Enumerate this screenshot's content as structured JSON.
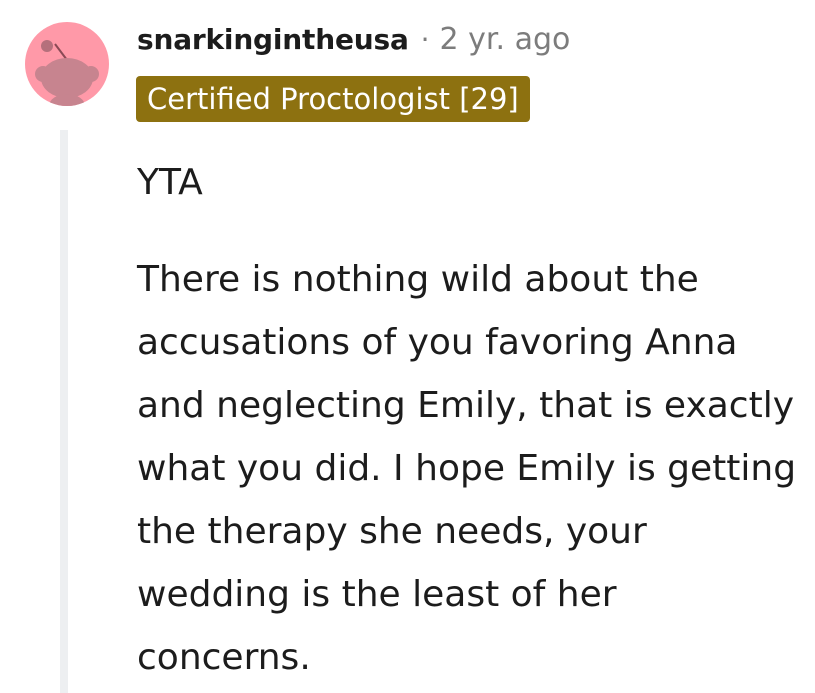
{
  "comment": {
    "username": "snarkingintheusa",
    "separator": "·",
    "timestamp": "2 yr. ago",
    "flair": "Certified Proctologist [29]",
    "body": [
      "YTA",
      "There is nothing wild about the accusations of you favoring Anna and neglecting Emily, that is exactly what you did. I hope Emily is getting the therapy she needs, your wedding is the least of her concerns."
    ],
    "avatar_icon": "snoo-avatar-icon",
    "colors": {
      "avatar_bg": "#ff99a8",
      "flair_bg": "#8d7110",
      "thread_line": "#edeff1",
      "muted_text": "#7c7c7c"
    }
  }
}
